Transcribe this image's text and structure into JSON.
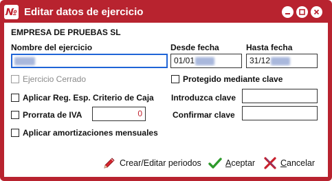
{
  "window": {
    "title": "Editar datos de ejercicio",
    "app_icon_text": "№",
    "accent_color": "#b8232f"
  },
  "company": {
    "name": "EMPRESA DE PRUEBAS SL"
  },
  "fields": {
    "nombre_label": "Nombre del ejercicio",
    "desde_label": "Desde fecha",
    "desde_value": "01/01",
    "hasta_label": "Hasta fecha",
    "hasta_value": "31/12",
    "introduzca_clave_label": "Introduzca clave",
    "confirmar_clave_label": "Confirmar clave",
    "prorrata_value": "0"
  },
  "checkboxes": {
    "ejercicio_cerrado": "Ejercicio Cerrado",
    "protegido": "Protegido mediante clave",
    "criterio_caja": "Aplicar Reg. Esp. Criterio de Caja",
    "prorrata": "Prorrata de IVA",
    "amortizaciones": "Aplicar amortizaciones mensuales"
  },
  "actions": {
    "crear_periodos_prefix": "Crear/Editar periodos",
    "aceptar_underline": "A",
    "aceptar_rest": "ceptar",
    "cancelar_underline": "C",
    "cancelar_rest": "ancelar"
  }
}
